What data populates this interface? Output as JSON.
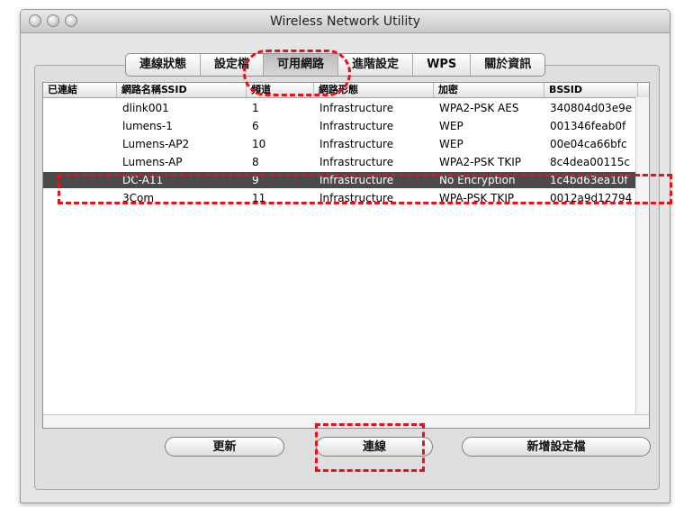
{
  "window": {
    "title": "Wireless Network Utility"
  },
  "tabs": [
    {
      "label": "連線狀態"
    },
    {
      "label": "設定檔"
    },
    {
      "label": "可用網路"
    },
    {
      "label": "進階設定"
    },
    {
      "label": "WPS"
    },
    {
      "label": "關於資訊"
    }
  ],
  "active_tab": "可用網路",
  "table": {
    "headers": [
      "已連結",
      "網路名稱SSID",
      "頻道",
      "網路形態",
      "加密",
      "BSSID"
    ],
    "rows": [
      {
        "connected": "",
        "ssid": "dlink001",
        "channel": "1",
        "type": "Infrastructure",
        "encryption": "WPA2-PSK AES",
        "bssid": "340804d03e9e"
      },
      {
        "connected": "",
        "ssid": "lumens-1",
        "channel": "6",
        "type": "Infrastructure",
        "encryption": "WEP",
        "bssid": "001346feab0f"
      },
      {
        "connected": "",
        "ssid": "Lumens-AP2",
        "channel": "10",
        "type": "Infrastructure",
        "encryption": "WEP",
        "bssid": "00e04ca66bfc"
      },
      {
        "connected": "",
        "ssid": "Lumens-AP",
        "channel": "8",
        "type": "Infrastructure",
        "encryption": "WPA2-PSK TKIP",
        "bssid": "8c4dea00115c"
      },
      {
        "connected": "",
        "ssid": "DC-A11",
        "channel": "9",
        "type": "Infrastructure",
        "encryption": "No Encryption",
        "bssid": "1c4bd63ea10f"
      },
      {
        "connected": "",
        "ssid": "3Com",
        "channel": "11",
        "type": "Infrastructure",
        "encryption": "WPA-PSK TKIP",
        "bssid": "0012a9d12794"
      }
    ],
    "selected_ssid": "DC-A11"
  },
  "buttons": {
    "refresh": "更新",
    "connect": "連線",
    "add_profile": "新增設定檔"
  },
  "colors": {
    "highlight_dash": "#e8101a",
    "selected_row": "#4a4a4a"
  }
}
